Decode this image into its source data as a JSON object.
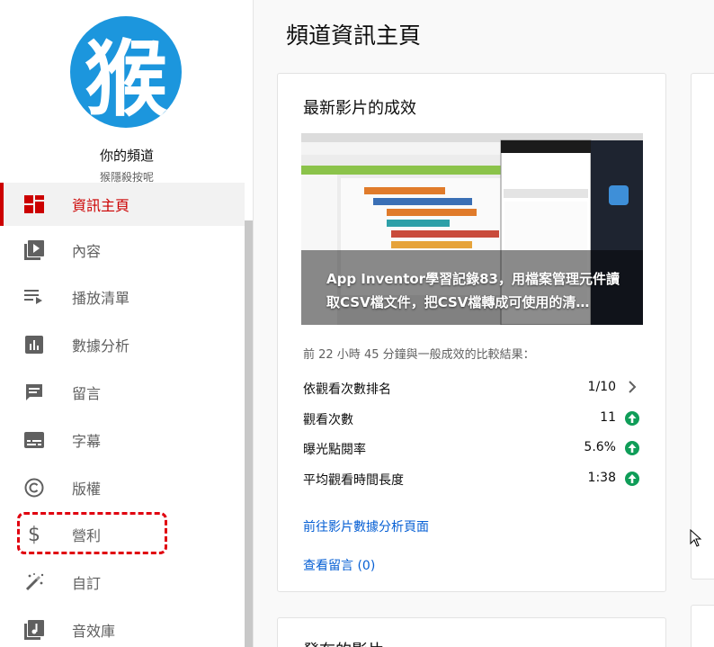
{
  "sidebar": {
    "avatar_text": "猴",
    "channel_name": "你的頻道",
    "channel_sub": "猴隱殺按呢",
    "items": [
      {
        "label": "資訊主頁",
        "icon": "dashboard-icon"
      },
      {
        "label": "內容",
        "icon": "video-library-icon"
      },
      {
        "label": "播放清單",
        "icon": "playlist-icon"
      },
      {
        "label": "數據分析",
        "icon": "analytics-icon"
      },
      {
        "label": "留言",
        "icon": "comment-icon"
      },
      {
        "label": "字幕",
        "icon": "subtitles-icon"
      },
      {
        "label": "版權",
        "icon": "copyright-icon"
      },
      {
        "label": "營利",
        "icon": "dollar-icon"
      },
      {
        "label": "自訂",
        "icon": "magic-wand-icon"
      },
      {
        "label": "音效庫",
        "icon": "audio-library-icon"
      }
    ]
  },
  "main": {
    "page_title": "頻道資訊主頁",
    "latest_video": {
      "card_title": "最新影片的成效",
      "video_title": "App Inventor學習記錄83，用檔案管理元件讀取CSV檔文件，把CSV檔轉成可使用的清…",
      "compare_text": "前 22 小時 45 分鐘與一般成效的比較結果：",
      "stats": [
        {
          "label": "依觀看次數排名",
          "value": "1/10",
          "indicator": "chevron-right-icon"
        },
        {
          "label": "觀看次數",
          "value": "11",
          "indicator": "arrow-up-icon"
        },
        {
          "label": "曝光點閱率",
          "value": "5.6%",
          "indicator": "arrow-up-icon"
        },
        {
          "label": "平均觀看時間長度",
          "value": "1:38",
          "indicator": "arrow-up-icon"
        }
      ],
      "analytics_link": "前往影片數據分析頁面",
      "comments_link": "查看留言 (0)"
    },
    "published_card_title": "發布的影片"
  },
  "colors": {
    "accent_red": "#cc0000",
    "link_blue": "#065fd4",
    "up_green": "#0f9d58",
    "avatar_blue": "#1c96dd"
  }
}
